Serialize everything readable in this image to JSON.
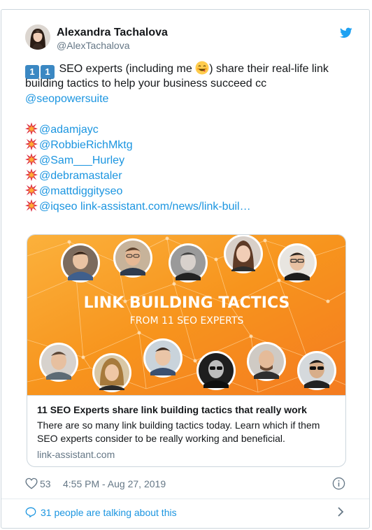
{
  "author": {
    "name": "Alexandra Tachalova",
    "handle": "@AlexTachalova"
  },
  "tweet": {
    "keycap_digit": "1",
    "line1_text": " SEO experts (including me ",
    "line1_end": ") share their real-life link",
    "line2": "building tactics to help your business succeed cc",
    "mention_main": "@seopowersuite",
    "mentions": [
      "@adamjayc",
      "@RobbieRichMktg",
      "@Sam___Hurley",
      "@debramastaler",
      "@mattdiggityseo"
    ],
    "last_mention": "@iqseo",
    "last_link": "link-assistant.com/news/link-buil…"
  },
  "card": {
    "banner_title": "LINK BUILDING TACTICS",
    "banner_subtitle": "FROM 11 SEO EXPERTS",
    "title": "11 SEO Experts share link building tactics that really work",
    "description": "There are so many link building tactics today. Learn which if them SEO experts consider to be really working and beneficial.",
    "domain": "link-assistant.com"
  },
  "stats": {
    "likes": "53",
    "timestamp": "4:55 PM - Aug 27, 2019"
  },
  "talking": {
    "text": "31 people are talking about this"
  },
  "colors": {
    "link_blue": "#1b95e0",
    "twitter_blue": "#1da1f2",
    "banner_orange": "#f7941d",
    "border": "#ccd6dd",
    "muted": "#657786"
  },
  "icons": [
    "twitter-bird-icon",
    "keycap-one-icon",
    "smiling-face-icon",
    "collision-icon",
    "heart-icon",
    "info-icon",
    "speech-bubble-icon",
    "chevron-right-icon"
  ]
}
